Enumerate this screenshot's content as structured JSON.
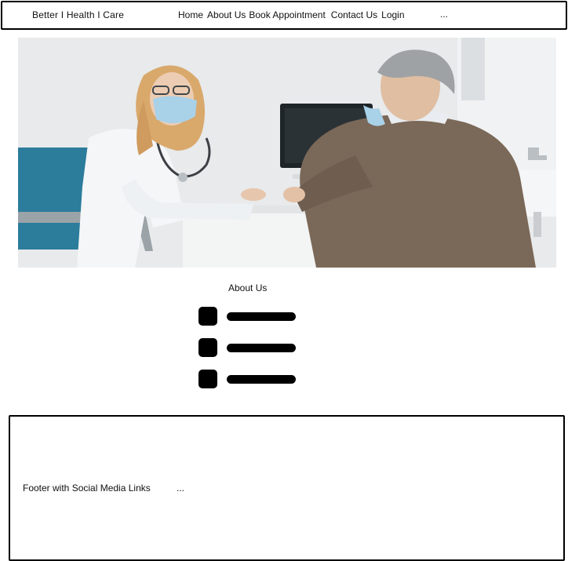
{
  "header": {
    "brand": "Better I Health I Care",
    "nav": [
      {
        "label": "Home"
      },
      {
        "label": "About Us"
      },
      {
        "label": "Book Appointment"
      },
      {
        "label": "Contact Us"
      },
      {
        "label": "Login"
      }
    ],
    "more": "..."
  },
  "hero": {
    "image_subject": "doctor-consultation-photo"
  },
  "about": {
    "title": "About Us",
    "list_item_count": 3
  },
  "footer": {
    "text": "Footer with Social Media Links",
    "more": "..."
  },
  "colors": {
    "border": "#000000",
    "background": "#ffffff",
    "placeholder": "#000000"
  }
}
